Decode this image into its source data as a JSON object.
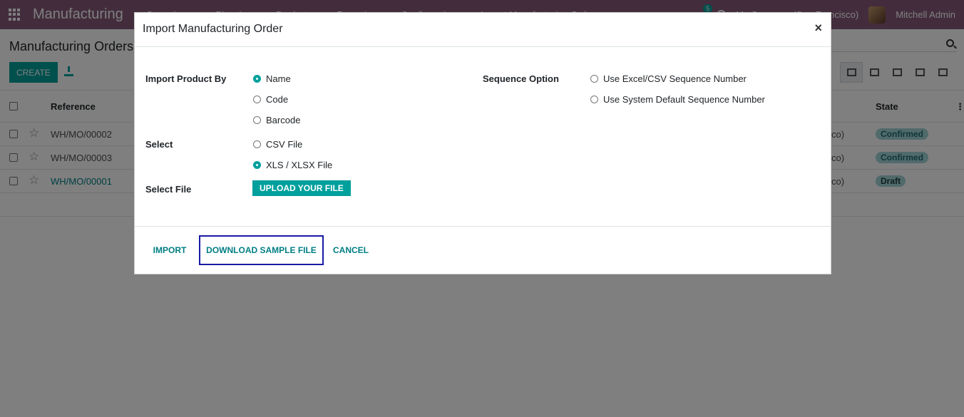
{
  "navbar": {
    "app_name": "Manufacturing",
    "menu": [
      "Operations",
      "Planning",
      "Products",
      "Reporting",
      "Configuration",
      "Import Manufacturing Order"
    ],
    "chat_count": "5",
    "company": "My Company (San Francisco)",
    "user": "Mitchell Admin"
  },
  "control_panel": {
    "breadcrumb": "Manufacturing Orders",
    "create_label": "CREATE"
  },
  "list": {
    "headers": {
      "reference": "Reference",
      "state": "State"
    },
    "rows": [
      {
        "reference": "WH/MO/00002",
        "company_partial": "co)",
        "state": "Confirmed"
      },
      {
        "reference": "WH/MO/00003",
        "company_partial": "co)",
        "state": "Confirmed"
      },
      {
        "reference": "WH/MO/00001",
        "company_partial": "co)",
        "state": "Draft"
      }
    ]
  },
  "dialog": {
    "title": "Import Manufacturing Order",
    "close_symbol": "×",
    "import_product_by": {
      "label": "Import Product By",
      "options": [
        "Name",
        "Code",
        "Barcode"
      ],
      "selected": "Name"
    },
    "sequence_option": {
      "label": "Sequence Option",
      "options": [
        "Use Excel/CSV Sequence Number",
        "Use System Default Sequence Number"
      ],
      "selected": "none"
    },
    "select": {
      "label": "Select",
      "options": [
        "CSV File",
        "XLS / XLSX File"
      ],
      "selected": "XLS / XLSX File"
    },
    "select_file": {
      "label": "Select File",
      "button": "UPLOAD YOUR FILE"
    },
    "footer": {
      "import": "IMPORT",
      "download_sample": "DOWNLOAD SAMPLE FILE",
      "cancel": "CANCEL"
    }
  },
  "colors": {
    "navbar": "#875a7b",
    "primary": "#00a09d",
    "link": "#017e84",
    "focus_outline": "#1a1aa6"
  }
}
